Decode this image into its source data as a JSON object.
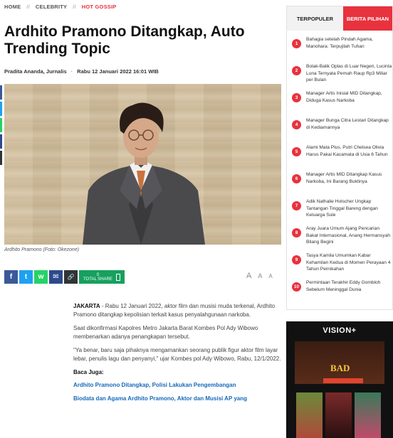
{
  "breadcrumb": {
    "home": "HOME",
    "section": "CELEBRITY",
    "sub": "HOT GOSSIP",
    "separator": "//"
  },
  "article": {
    "title": "Ardhito Pramono Ditangkap, Auto Trending Topic",
    "authors": "Pradita Ananda, Jurnalis",
    "date": "Rabu 12 Januari 2022 16:01 WIB",
    "photo_caption": "Ardhito Pramono (Foto: Okezone)",
    "lead_city": "JAKARTA",
    "lead_rest": " - Rabu 12 Januari 2022, aktor film dan musisi muda terkenal, Ardhito Pramono ditangkap kepolisian terkait kasus penyalahgunaan narkoba.",
    "para2": "Saat dikonfirmasi Kapolres Metro Jakarta Barat Kombes Pol Ady Wibowo membenarkan adanya penangkapan tersebut.",
    "para3": "\"Ya benar, baru saja pihaknya mengamankan seorang publik figur aktor film layar lebar, penulis lagu dan penyanyi,\" ujar Kombes pol Ady Wibowo, Rabu, 12/1/2022.",
    "baca_juga": "Baca Juga:",
    "related": [
      "Ardhito Pramono Ditangkap, Polisi Lakukan Pengembangan",
      "Biodata dan Agama Ardhito Pramono, Aktor dan Musisi AP yang"
    ]
  },
  "share": {
    "facebook_glyph": "f",
    "twitter_glyph": "t",
    "whatsapp_glyph": "w",
    "email_glyph": "✉",
    "link_glyph": "🔗",
    "total_count": "0",
    "total_label": "TOTAL SHARE",
    "colors": {
      "facebook": "#3b5998",
      "twitter": "#1da1f2",
      "whatsapp": "#25d366",
      "email": "#2c4a8c",
      "link": "#333333",
      "total": "#17a05e"
    }
  },
  "font_size_controls": [
    "A",
    "A",
    "A"
  ],
  "sidebar": {
    "tab_popular": "TERPOPULER",
    "tab_choice": "BERITA PILIHAN",
    "items": [
      {
        "n": "1",
        "title": "Bahagia setelah Pindah Agama, Manohara: Terpujilah Tuhan"
      },
      {
        "n": "2",
        "title": "Bolak-Balik Oplas di Luar Negeri, Lucinta Luna Ternyata Pernah Raup Rp3 Miliar per Bulan"
      },
      {
        "n": "3",
        "title": "Manager Artis Inisial MID Ditangkap, Diduga Kasus Narkoba"
      },
      {
        "n": "4",
        "title": "Manager Bunga Citra Lestari Ditangkap di Kediamannya"
      },
      {
        "n": "5",
        "title": "Alami Mata Plus, Putri Chelsea Olivia Harus Pakai Kacamata di Usia 6 Tahun"
      },
      {
        "n": "6",
        "title": "Manager Artis MID Ditangkap Kasus Narkoba, Ini Barang Buktinya"
      },
      {
        "n": "7",
        "title": "Adik Nathalie Holscher Ungkap Tantangan Tinggal Bareng dengan Keluarga Sule"
      },
      {
        "n": "8",
        "title": "Aray Juara Umum Ajang Pencarian Bakat Internasional, Anang Hermansyah Bilang Begini"
      },
      {
        "n": "9",
        "title": "Tasya Kamila Umumkan Kabar Kehamilan Kedua di Momen Perayaan 4 Tahun Pernikahan"
      },
      {
        "n": "10",
        "title": "Permintaan Terakhir Eddy Gombloh Sebelum Meninggal Dunia"
      }
    ]
  },
  "ad": {
    "brand": "VISION+",
    "promo_title": "BAD"
  },
  "colors": {
    "accent": "#e8323e",
    "link": "#1769b8"
  }
}
